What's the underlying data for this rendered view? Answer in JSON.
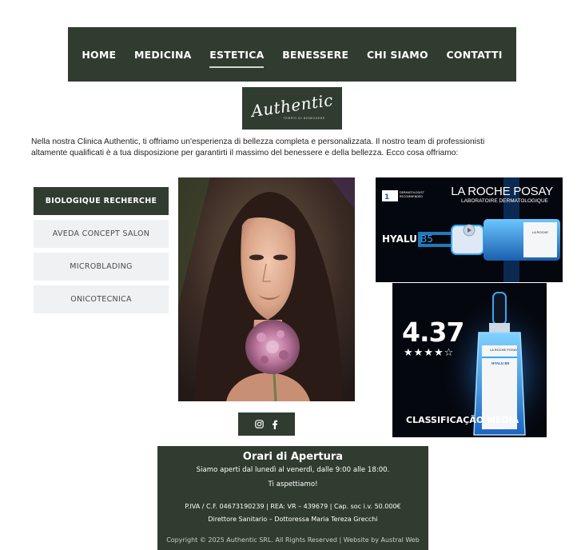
{
  "nav": {
    "items": [
      {
        "label": "HOME",
        "active": false
      },
      {
        "label": "MEDICINA",
        "active": false
      },
      {
        "label": "ESTETICA",
        "active": true
      },
      {
        "label": "BENESSERE",
        "active": false
      },
      {
        "label": "CHI SIAMO",
        "active": false
      },
      {
        "label": "CONTATTI",
        "active": false
      }
    ]
  },
  "logo": {
    "text": "Authentic",
    "tagline": "TEMPIO DI BENESSERE"
  },
  "intro": {
    "text": "Nella nostra Clinica Authentic, ti offriamo un'esperienza di bellezza completa e personalizzata. Il nostro team di professionisti altamente qualificati è a tua disposizione per garantirti il massimo del benessere e della bellezza. Ecco cosa offriamo:"
  },
  "services": {
    "items": [
      {
        "label": "BIOLOGIQUE RECHERCHE",
        "active": true
      },
      {
        "label": "AVEDA CONCEPT SALON",
        "active": false
      },
      {
        "label": "MICROBLADING",
        "active": false
      },
      {
        "label": "ONICOTECNICA",
        "active": false
      }
    ]
  },
  "ad1": {
    "badge_line1": "DERMATOLOGIST",
    "badge_line2": "RECOMMENDED",
    "brand": "LA ROCHE POSAY",
    "subtitle": "LABORATOIRE DERMATOLOGIQUE",
    "product": "HYALU",
    "product_suffix": "B5"
  },
  "ad2": {
    "rating": "4.37",
    "stars": 4.37,
    "caption": "CLASSIFICAÇÃO MÉDIA",
    "bottle_brand": "LA ROCHE POSAY",
    "bottle_product": "HYALU B5"
  },
  "social": {
    "icons": [
      "instagram-icon",
      "facebook-icon"
    ]
  },
  "footer": {
    "title": "Orari di Apertura",
    "hours": "Siamo aperti dal lunedì al venerdì, dalle 9:00 alle 18:00.",
    "greeting": "Ti aspettiamo!",
    "company": "P.IVA  / C.F. 04673190239 | REA: VR – 439679 | Cap. soc i.v. 50.000€",
    "director": "Direttore Sanitario – Dottoressa Maria Tereza Grecchi",
    "copyright": "Copyright © 2025 Authentic SRL. All Rights Reserved | ",
    "website_link": "Website by Austral Web"
  },
  "colors": {
    "brand_green": "#303c30",
    "menu_inactive_bg": "#f0f1f3",
    "ad_blue": "#2fa9ff"
  }
}
